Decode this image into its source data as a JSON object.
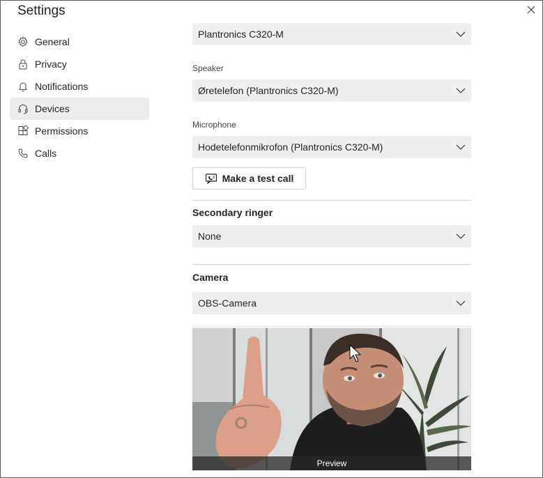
{
  "window": {
    "title": "Settings"
  },
  "sidebar": {
    "items": [
      {
        "label": "General",
        "icon": "gear-icon"
      },
      {
        "label": "Privacy",
        "icon": "lock-icon"
      },
      {
        "label": "Notifications",
        "icon": "bell-icon"
      },
      {
        "label": "Devices",
        "icon": "headset-icon",
        "selected": true
      },
      {
        "label": "Permissions",
        "icon": "apps-icon"
      },
      {
        "label": "Calls",
        "icon": "phone-icon"
      }
    ]
  },
  "devices": {
    "audio_device": {
      "value": "Plantronics C320-M"
    },
    "speaker": {
      "label": "Speaker",
      "value": "Øretelefon (Plantronics C320-M)"
    },
    "microphone": {
      "label": "Microphone",
      "value": "Hodetelefonmikrofon (Plantronics C320-M)"
    },
    "test_call_label": "Make a test call",
    "secondary_ringer": {
      "heading": "Secondary ringer",
      "value": "None"
    },
    "camera": {
      "heading": "Camera",
      "value": "OBS-Camera",
      "preview_label": "Preview"
    }
  },
  "colors": {
    "dropdown_bg": "#f0efee",
    "selected_nav_bg": "#ededed",
    "text": "#252423"
  }
}
